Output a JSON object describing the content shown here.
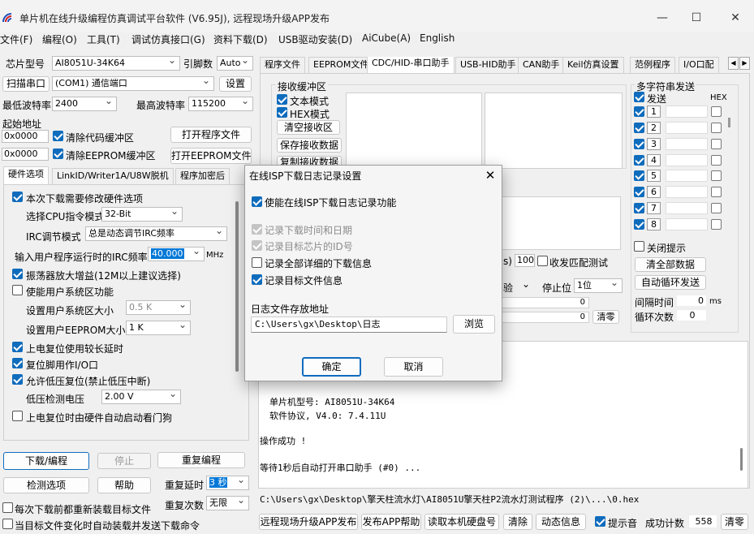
{
  "window": {
    "title": "单片机在线升级编程仿真调试平台软件 (V6.95J), 远程现场升级APP发布"
  },
  "menu": [
    "文件(F)",
    "编程(O)",
    "工具(T)",
    "调试仿真接口(G)",
    "资料下载(D)",
    "USB驱动安装(D)",
    "AiCube(A)",
    "English"
  ],
  "left": {
    "chip_label": "芯片型号",
    "chip_value": "AI8051U-34K64",
    "pin_label": "引脚数",
    "pin_value": "Auto",
    "scan_port": "扫描串口",
    "port_value": "(COM1) 通信端口",
    "settings": "设置",
    "min_baud_label": "最低波特率",
    "min_baud": "2400",
    "max_baud_label": "最高波特率",
    "max_baud": "115200",
    "start_addr_label": "起始地址",
    "addr1": "0x0000",
    "clear_code": "清除代码缓冲区",
    "open_prog": "打开程序文件",
    "addr2": "0x0000",
    "clear_eeprom": "清除EEPROM缓冲区",
    "open_eeprom": "打开EEPROM文件",
    "tabs": [
      "硬件选项",
      "LinkID/Writer1A/U8W脱机",
      "程序加密后"
    ],
    "hw": {
      "o1": "本次下载需要修改硬件选项",
      "o2_label": "选择CPU指令模式",
      "o2_value": "32-Bit",
      "o3_label": "IRC调节模式",
      "o3_value": "总是动态调节IRC频率",
      "o4_label": "输入用户程序运行时的IRC频率",
      "o4_value": "40.000",
      "o4_unit": "MHz",
      "o5": "振荡器放大增益(12M以上建议选择)",
      "o6": "使能用户系统区功能",
      "o7_label": "设置用户系统区大小",
      "o7_value": "0.5 K",
      "o8_label": "设置用户EEPROM大小",
      "o8_value": "1   K",
      "o9": "上电复位使用较长延时",
      "o10": "复位脚用作I/O口",
      "o11": "允许低压复位(禁止低压中断)",
      "o12_label": "低压检测电压",
      "o12_value": "2.00 V",
      "o13": "上电复位时由硬件自动启动看门狗"
    },
    "download": "下载/编程",
    "stop": "停止",
    "reprog": "重复编程",
    "check": "检测选项",
    "help": "帮助",
    "repeat_delay_label": "重复延时",
    "repeat_delay": "3 秒",
    "repeat_count_label": "重复次数",
    "repeat_count": "无限",
    "reload_each": "每次下载前都重新装载目标文件",
    "auto_reload": "当目标文件变化时自动装载并发送下载命令"
  },
  "right": {
    "tabs": [
      "程序文件",
      "EEPROM文件",
      "CDC/HID-串口助手",
      "USB-HID助手",
      "CAN助手",
      "Keil仿真设置",
      "范例程序",
      "I/O口配"
    ],
    "recv_title": "接收缓冲区",
    "text_mode": "文本模式",
    "hex_mode": "HEX模式",
    "clear_recv": "清空接收区",
    "save_recv": "保存接收数据",
    "copy_recv": "复制接收数据",
    "ms_suffix": "s)",
    "timeout_value": "100",
    "recv_match": "收发匹配测试",
    "check_partial": "验",
    "stopbit_label": "停止位",
    "stopbit_value": "1位",
    "zero1": "0",
    "zero2": "0",
    "clear_count": "清零",
    "multi_title": "多字符串发送",
    "send": "发送",
    "hex": "HEX",
    "rows": [
      "1",
      "2",
      "3",
      "4",
      "5",
      "6",
      "7",
      "8"
    ],
    "close_tip": "关闭提示",
    "clear_all": "清全部数据",
    "auto_loop": "自动循环发送",
    "interval_label": "间隔时间",
    "interval_value": "0",
    "interval_unit": "ms",
    "loop_label": "循环次数",
    "loop_value": "0",
    "log": {
      "chip": "单片机型号: AI8051U-34K64",
      "proto": "软件协议, V4.0: 7.4.11U",
      "ok": "操作成功 !",
      "wait": "等待1秒后自动打开串口助手 (#0) ..."
    },
    "path": "C:\\Users\\gx\\Desktop\\擎天柱流水灯\\AI8051U擎天柱P2流水灯测试程序 (2)\\...\\0.hex",
    "bottom": {
      "remote": "远程现场升级APP发布",
      "publish_help": "发布APP帮助",
      "read_disk": "读取本机硬盘号",
      "clear": "清除",
      "anim": "动态信息",
      "beep": "提示音",
      "success_label": "成功计数",
      "success_value": "558",
      "clear_zero": "清零"
    }
  },
  "dialog": {
    "title": "在线ISP下载日志记录设置",
    "enable": "使能在线ISP下载日志记录功能",
    "rec_time": "记录下载时间和日期",
    "rec_id": "记录目标芯片的ID号",
    "rec_all": "记录全部详细的下载信息",
    "rec_file": "记录目标文件信息",
    "path_label": "日志文件存放地址",
    "path_value": "C:\\Users\\gx\\Desktop\\日志",
    "browse": "浏览",
    "ok": "确定",
    "cancel": "取消"
  }
}
